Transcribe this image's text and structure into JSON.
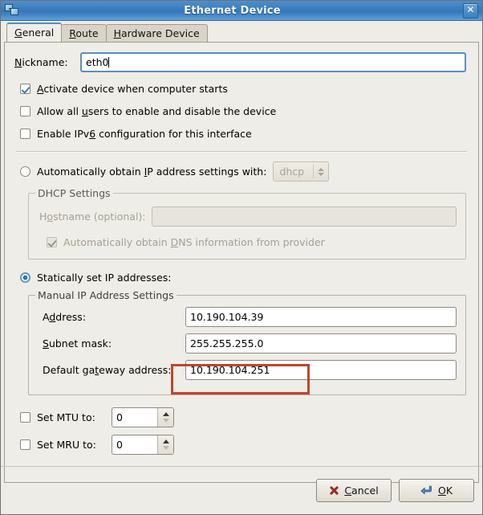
{
  "window": {
    "title": "Ethernet Device",
    "icon": "network-device-icon",
    "close_label": "✕"
  },
  "tabs": [
    {
      "label": "General",
      "mnemonic": "G",
      "active": true
    },
    {
      "label": "Route",
      "mnemonic": "R",
      "active": false
    },
    {
      "label": "Hardware Device",
      "mnemonic": "H",
      "active": false
    }
  ],
  "general": {
    "nickname": {
      "label": "Nickname:",
      "mnemonic": "N",
      "value": "eth0",
      "focused": true
    },
    "checkboxes": [
      {
        "label": "Activate device when computer starts",
        "mnemonic": "A",
        "checked": true,
        "enabled": true
      },
      {
        "label": "Allow all users to enable and disable the device",
        "mnemonic": "u",
        "checked": false,
        "enabled": true
      },
      {
        "label": "Enable IPv6 configuration for this interface",
        "mnemonic": "6",
        "checked": false,
        "enabled": true
      }
    ],
    "auto_ip": {
      "radio_label": "Automatically obtain IP address settings with:",
      "mnemonic": "I",
      "selected": false,
      "protocol_value": "dhcp",
      "protocol_enabled": false
    },
    "dhcp_group": {
      "title": "DHCP Settings",
      "enabled": false,
      "hostname_label": "Hostname (optional):",
      "hostname_mnemonic": "o",
      "hostname_value": "",
      "dns_label": "Automatically obtain DNS information from provider",
      "dns_mnemonic": "D",
      "dns_checked": true
    },
    "static_ip": {
      "radio_label": "Statically set IP addresses:",
      "selected": true,
      "group_title": "Manual IP Address Settings",
      "fields": [
        {
          "label": "Address:",
          "mnemonic": "d",
          "value": "10.190.104.39"
        },
        {
          "label": "Subnet mask:",
          "mnemonic": "S",
          "value": "255.255.255.0"
        },
        {
          "label": "Default gateway address:",
          "mnemonic": "t",
          "value": "10.190.104.251"
        }
      ]
    },
    "mtu": {
      "label": "Set MTU to:",
      "checked": false,
      "value": "0"
    },
    "mru": {
      "label": "Set MRU to:",
      "checked": false,
      "value": "0"
    }
  },
  "annotation": {
    "color": "#c0452f",
    "target": "default-gateway-address-row"
  },
  "buttons": {
    "cancel": {
      "label": "Cancel",
      "mnemonic": "C",
      "icon": "cancel-x-icon"
    },
    "ok": {
      "label": "OK",
      "mnemonic": "O",
      "icon": "enter-arrow-icon"
    }
  }
}
